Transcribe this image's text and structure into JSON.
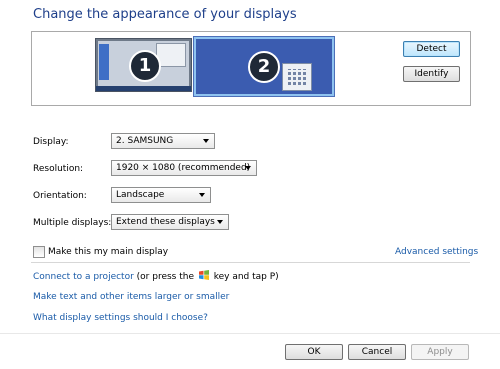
{
  "page_title": "Change the appearance of your displays",
  "buttons": {
    "detect": "Detect",
    "identify": "Identify",
    "ok": "OK",
    "cancel": "Cancel",
    "apply": "Apply"
  },
  "monitors": [
    {
      "number": "1"
    },
    {
      "number": "2"
    }
  ],
  "settings": {
    "display": {
      "label": "Display:",
      "value": "2. SAMSUNG"
    },
    "resolution": {
      "label": "Resolution:",
      "value": "1920 × 1080 (recommended)"
    },
    "orientation": {
      "label": "Orientation:",
      "value": "Landscape"
    },
    "multiple": {
      "label": "Multiple displays:",
      "value": "Extend these displays"
    }
  },
  "main_display": {
    "label": "Make this my main display",
    "checked": false
  },
  "links": {
    "advanced": "Advanced settings",
    "projector_link": "Connect to a projector",
    "projector_text_pre": " (or press the ",
    "projector_text_post": " key and tap P)",
    "text_larger": "Make text and other items larger or smaller",
    "what_settings": "What display settings should I choose?"
  },
  "icons": {
    "windows_key": "windows-logo-icon"
  }
}
